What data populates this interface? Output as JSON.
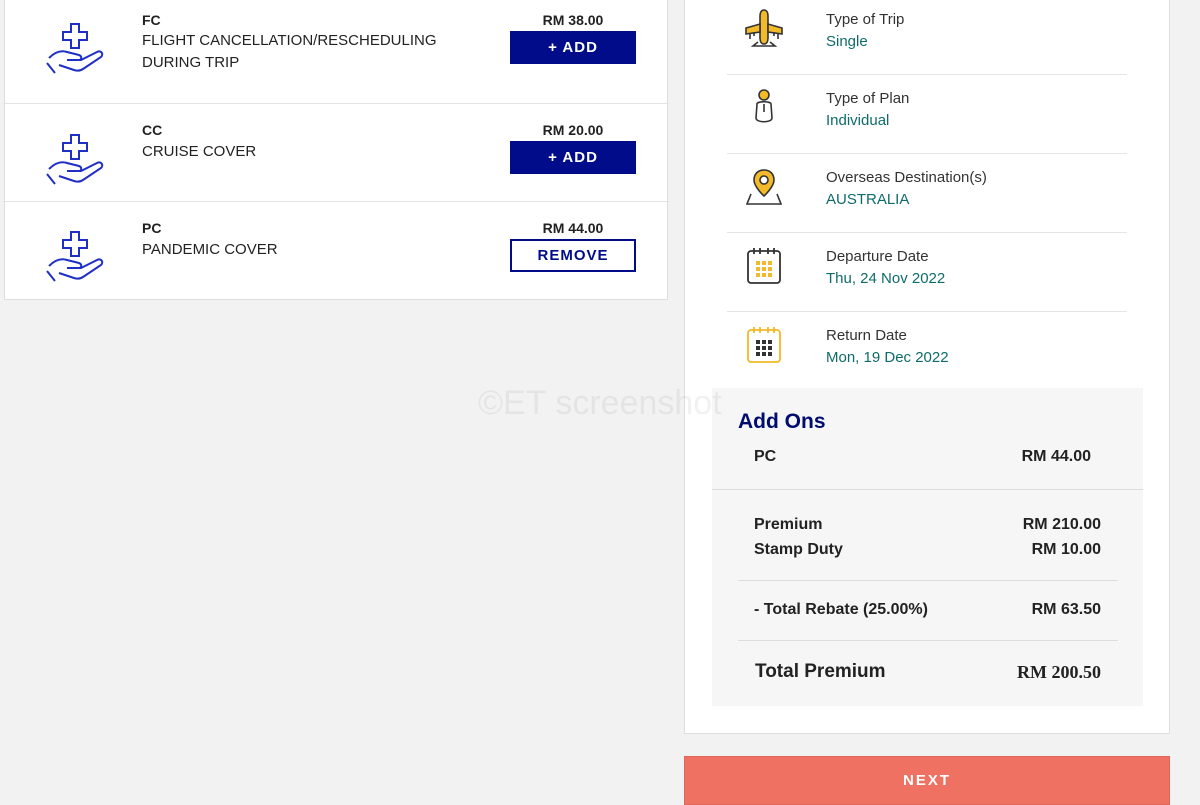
{
  "addons": [
    {
      "code": "FC",
      "name": "FLIGHT CANCELLATION/RESCHEDULING DURING TRIP",
      "price": "RM 38.00",
      "action": "+ ADD",
      "icon": "hand-medical-cross-icon"
    },
    {
      "code": "CC",
      "name": "CRUISE COVER",
      "price": "RM 20.00",
      "action": "+ ADD",
      "icon": "hand-medical-cross-icon"
    },
    {
      "code": "PC",
      "name": "PANDEMIC COVER",
      "price": "RM 44.00",
      "action": "REMOVE",
      "icon": "hand-medical-cross-icon"
    }
  ],
  "trip": {
    "type_of_trip": {
      "label": "Type of Trip",
      "value": "Single",
      "icon": "airplane-icon"
    },
    "type_of_plan": {
      "label": "Type of Plan",
      "value": "Individual",
      "icon": "person-icon"
    },
    "destination": {
      "label": "Overseas Destination(s)",
      "value": "AUSTRALIA",
      "icon": "map-pin-icon"
    },
    "departure": {
      "label": "Departure Date",
      "value": "Thu, 24 Nov 2022",
      "icon": "calendar-icon"
    },
    "return": {
      "label": "Return Date",
      "value": "Mon, 19 Dec 2022",
      "icon": "calendar-icon"
    }
  },
  "summary": {
    "addons_title": "Add Ons",
    "selected_addon": {
      "code": "PC",
      "price": "RM 44.00"
    },
    "premium": {
      "label": "Premium",
      "value": "RM 210.00"
    },
    "stamp_duty": {
      "label": "Stamp Duty",
      "value": "RM 10.00"
    },
    "rebate": {
      "label": "- Total Rebate (25.00%)",
      "value": "RM 63.50"
    },
    "total": {
      "label": "Total Premium",
      "value": "RM 200.50"
    }
  },
  "next_label": "NEXT",
  "watermark": "©ET screenshot",
  "colors": {
    "brand_navy": "#000c8a",
    "teal_value": "#0f6b6b",
    "accent_yellow": "#f2b928",
    "next_button": "#ef7162"
  }
}
